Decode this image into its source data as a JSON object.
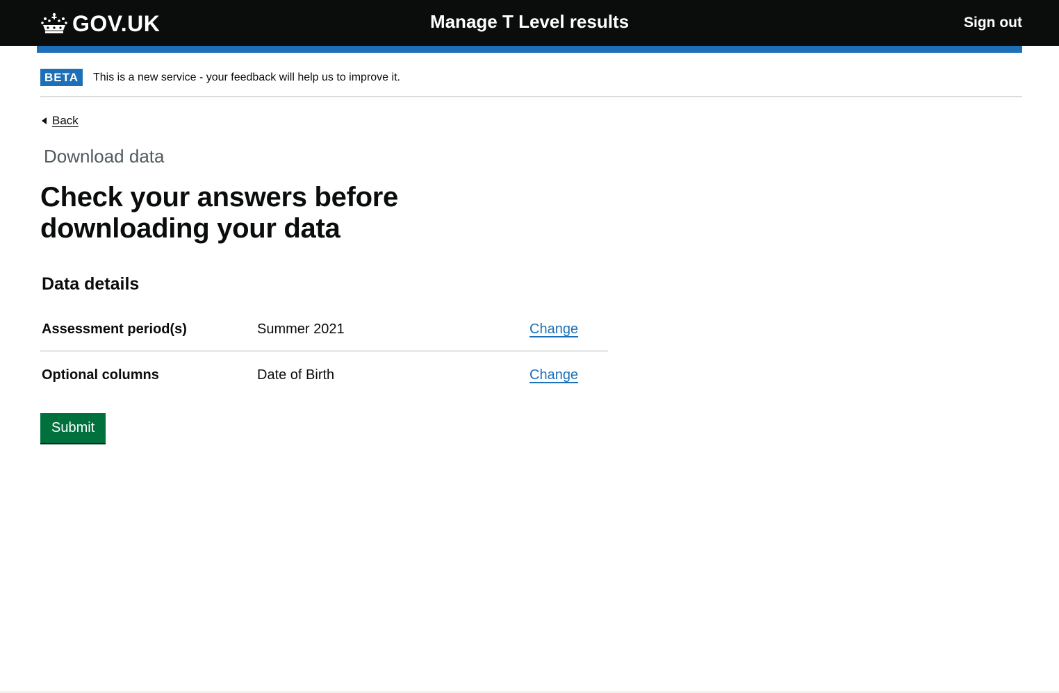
{
  "header": {
    "logo_text": "GOV.UK",
    "service_name": "Manage T Level results",
    "sign_out_label": "Sign out",
    "logo_icon": "crown-icon"
  },
  "phase_banner": {
    "tag": "BETA",
    "text": "This is a new service - your feedback will help us to improve it."
  },
  "back_link": {
    "label": "Back",
    "icon": "chevron-left-icon"
  },
  "main": {
    "caption": "Download data",
    "title": "Check your answers before downloading your data",
    "section_heading": "Data details",
    "rows": [
      {
        "key": "Assessment period(s)",
        "value": "Summer 2021",
        "action": "Change"
      },
      {
        "key": "Optional columns",
        "value": "Date of Birth",
        "action": "Change"
      }
    ],
    "submit_label": "Submit"
  },
  "colors": {
    "header_bg": "#0b0c0c",
    "brand_blue": "#1d70b8",
    "button_green": "#00703c",
    "caption_grey": "#505a5f"
  }
}
